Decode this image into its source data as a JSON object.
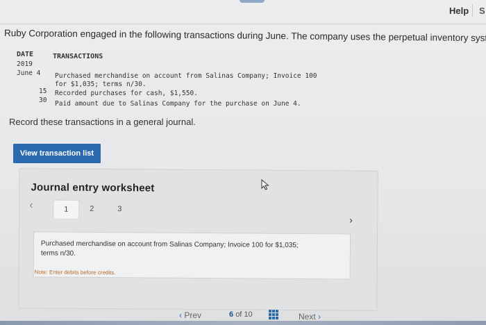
{
  "header": {
    "help_label": "Help",
    "truncated_label": "S"
  },
  "problem": {
    "intro": "Ruby Corporation engaged in the following transactions during June. The company uses the perpetual inventory system",
    "table": {
      "col_date": "DATE",
      "col_transactions": "TRANSACTIONS",
      "year": "2019",
      "rows": [
        {
          "date": "June  4",
          "text": "Purchased merchandise on account from Salinas Company; Invoice 100",
          "cont": "for $1,035; terms n/30."
        },
        {
          "date": "15",
          "text": "Recorded purchases for cash, $1,550."
        },
        {
          "date": "30",
          "text": "Paid amount due to Salinas Company for the purchase on June 4."
        }
      ]
    },
    "instruction": "Record these transactions in a general journal."
  },
  "buttons": {
    "view_transactions": "View transaction list"
  },
  "worksheet": {
    "title": "Journal entry worksheet",
    "tabs": [
      "1",
      "2",
      "3"
    ],
    "active_tab": 0,
    "description": "Purchased merchandise on account from Salinas Company; Invoice 100 for $1,035; terms n/30.",
    "note": "Note: Enter debits before credits."
  },
  "pager": {
    "prev_label": "Prev",
    "current_page": "6",
    "of_label": "of",
    "total_pages": "10",
    "next_label": "Next"
  },
  "icons": {
    "prev": "chevron-left-icon",
    "next": "chevron-right-icon",
    "grid": "grid-icon",
    "cursor": "mouse-cursor-icon"
  },
  "colors": {
    "accent": "#2a6bb0",
    "note": "#b86a2a"
  }
}
